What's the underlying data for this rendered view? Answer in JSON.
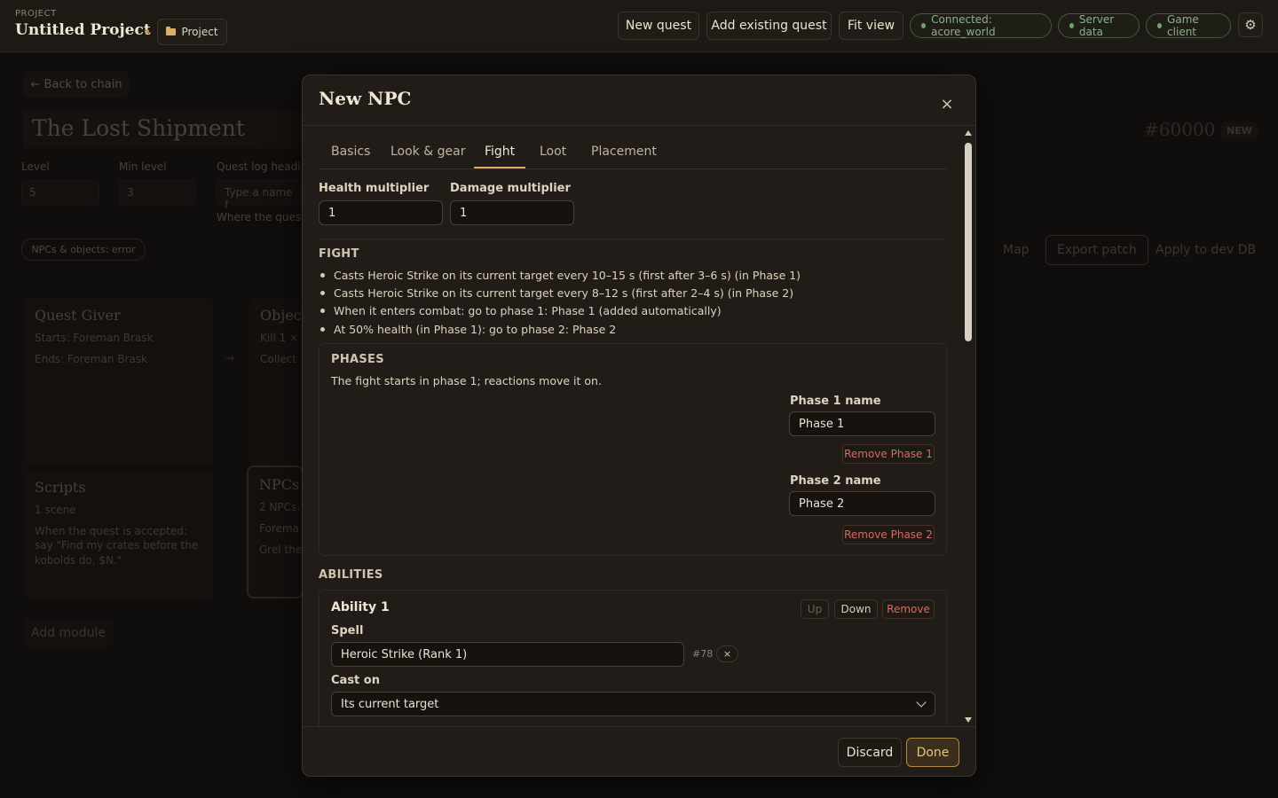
{
  "topbar": {
    "kicker": "PROJECT",
    "title": "Untitled Project",
    "project_chip": "Project",
    "buttons": [
      "New quest",
      "Add existing quest",
      "Fit view"
    ],
    "status": [
      "Connected: acore_world",
      "Server data",
      "Game client"
    ],
    "colors": {
      "accent": "#d9ad5c",
      "status_ok": "#6fa46b"
    }
  },
  "background": {
    "back": "← Back to chain",
    "quest_title": "The Lost Shipment",
    "quest_id": "#60000",
    "badge": "NEW",
    "fields": [
      {
        "label": "Level",
        "value": "5"
      },
      {
        "label": "Min level",
        "value": "3"
      },
      {
        "label": "Quest log headi",
        "value": "Type a name f"
      }
    ],
    "hint": "Where the quest",
    "chip": "NPCs & objects: error",
    "actions": [
      "Map",
      "Export patch",
      "Apply to dev DB"
    ],
    "cards": {
      "giver": {
        "title": "Quest Giver",
        "lines": [
          "Starts: Foreman Brask",
          "Ends: Foreman Brask"
        ]
      },
      "objectives": {
        "title": "Objec",
        "lines": [
          "Kill 1 × K",
          "Collect"
        ]
      },
      "scripts": {
        "title": "Scripts",
        "lines": [
          "1 scene",
          "When the quest is accepted: say \"Find my crates before the kobolds do, $N.\""
        ]
      },
      "npcs": {
        "title": "NPCs",
        "lines": [
          "2 NPCs,",
          "Forema",
          "Grel the"
        ]
      }
    },
    "arrow": "→",
    "add_module": "Add module"
  },
  "modal": {
    "title": "New NPC",
    "close": "×",
    "tabs": [
      "Basics",
      "Look & gear",
      "Fight",
      "Loot",
      "Placement"
    ],
    "active_tab": "Fight",
    "health_label": "Health multiplier",
    "health_value": "1",
    "damage_label": "Damage multiplier",
    "damage_value": "1",
    "fight_heading": "FIGHT",
    "fight_lines": [
      "Casts Heroic Strike on its current target every 10–15 s (first after 3–6 s) (in Phase 1)",
      "Casts Heroic Strike on its current target every 8–12 s (first after 2–4 s) (in Phase 2)",
      "When it enters combat: go to phase 1: Phase 1 (added automatically)",
      "At 50% health (in Phase 1): go to phase 2: Phase 2"
    ],
    "phases": {
      "heading": "PHASES",
      "desc": "The fight starts in phase 1; reactions move it on.",
      "p1_label": "Phase 1 name",
      "p1_value": "Phase 1",
      "p1_remove": "Remove Phase 1",
      "p2_label": "Phase 2 name",
      "p2_value": "Phase 2",
      "p2_remove": "Remove Phase 2"
    },
    "abilities": {
      "heading": "ABILITIES",
      "title": "Ability 1",
      "up": "Up",
      "down": "Down",
      "remove": "Remove",
      "spell_label": "Spell",
      "spell_value": "Heroic Strike (Rank 1)",
      "spell_id": "#78",
      "spell_clear": "×",
      "cast_label": "Cast on",
      "cast_value": "Its current target"
    },
    "discard": "Discard",
    "done": "Done"
  }
}
